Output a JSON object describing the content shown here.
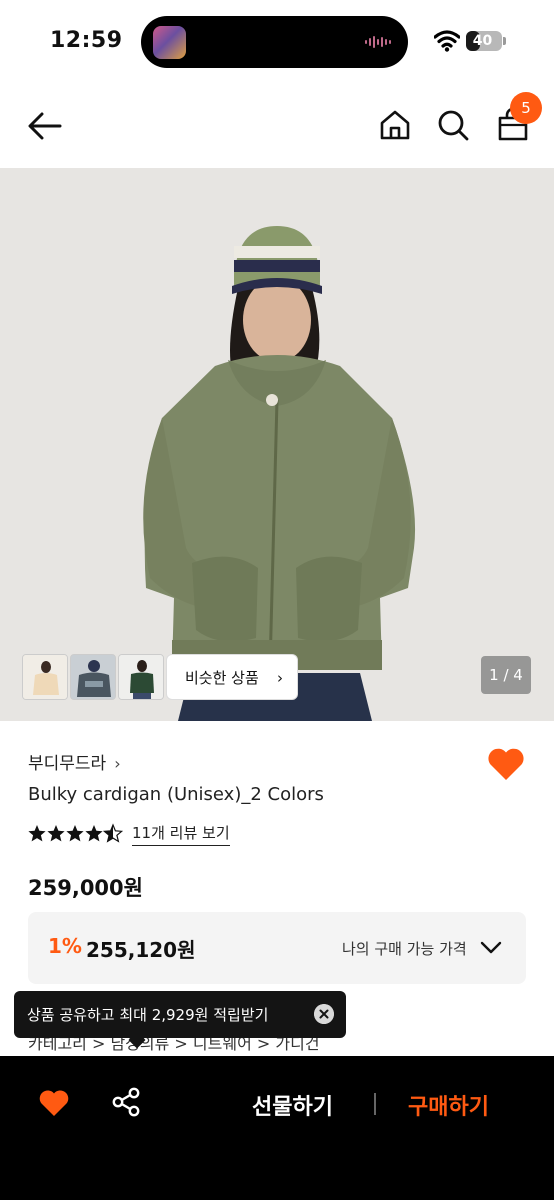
{
  "status_bar": {
    "time": "12:59",
    "battery": "40",
    "battery_level": 0.4
  },
  "header": {
    "cart_count": "5"
  },
  "gallery": {
    "similar_label": "비슷한 상품",
    "page_counter": "1 / 4"
  },
  "product": {
    "brand": "부디무드라",
    "name": "Bulky cardigan (Unisex)_2 Colors",
    "rating": 4.5,
    "review_link": "11개 리뷰 보기",
    "price": "259,000원",
    "discount": "1%",
    "sale_price": "255,120원",
    "my_price_label": "나의 구매 가능 가격"
  },
  "breadcrumb": "카테고리   >  남성의류  >  니트웨어  >  가디건",
  "toast": {
    "text": "상품 공유하고 최대 2,929원 적립받기"
  },
  "bottom_bar": {
    "gift_label": "선물하기",
    "buy_label": "구매하기"
  },
  "colors": {
    "accent": "#ff5a12",
    "hero_bg": "#e7e5e2",
    "cardigan": "#7d8866"
  }
}
